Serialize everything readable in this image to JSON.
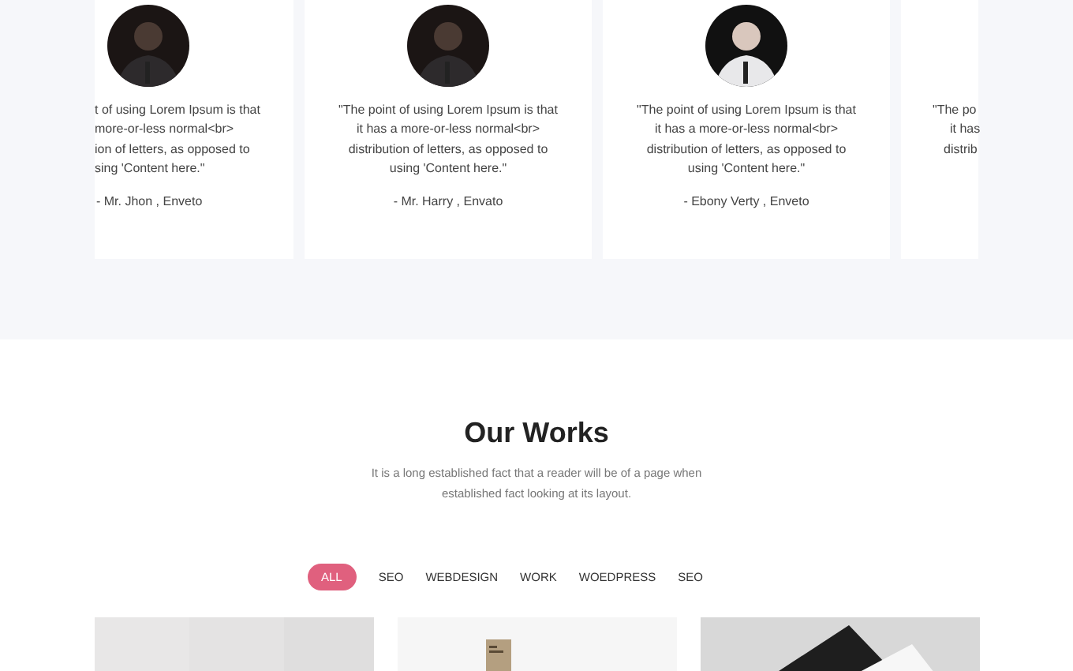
{
  "testimonials": [
    {
      "quote_lines": [
        "t of using Lorem Ipsum is that",
        "more-or-less normal<br>",
        "ion of letters, as opposed to",
        "sing 'Content here.\""
      ],
      "author": "- Mr. Jhon , Enveto",
      "kind": "cut-left"
    },
    {
      "quote_lines": [
        "\"The point of using Lorem Ipsum is that",
        "it has a more-or-less normal<br>",
        "distribution of letters, as opposed to",
        "using 'Content here.\""
      ],
      "author": "- Mr. Harry , Envato",
      "kind": "whole"
    },
    {
      "quote_lines": [
        "\"The point of using Lorem Ipsum is that",
        "it has a more-or-less normal<br>",
        "distribution of letters, as opposed to",
        "using 'Content here.\""
      ],
      "author": "- Ebony Verty , Enveto",
      "kind": "whole"
    },
    {
      "quote_lines": [
        "\"The po",
        "it has",
        "distrib"
      ],
      "kind": "cut-right"
    }
  ],
  "works": {
    "title": "Our Works",
    "subtitle": "It is a long established fact that a reader will be of a page when established fact looking at its layout.",
    "filters": [
      {
        "label": "ALL",
        "selected": true
      },
      {
        "label": "SEO",
        "selected": false
      },
      {
        "label": "WEBDESIGN",
        "selected": false
      },
      {
        "label": "WORK",
        "selected": false
      },
      {
        "label": "WOEDPRESS",
        "selected": false
      },
      {
        "label": "SEO",
        "selected": false
      }
    ]
  }
}
